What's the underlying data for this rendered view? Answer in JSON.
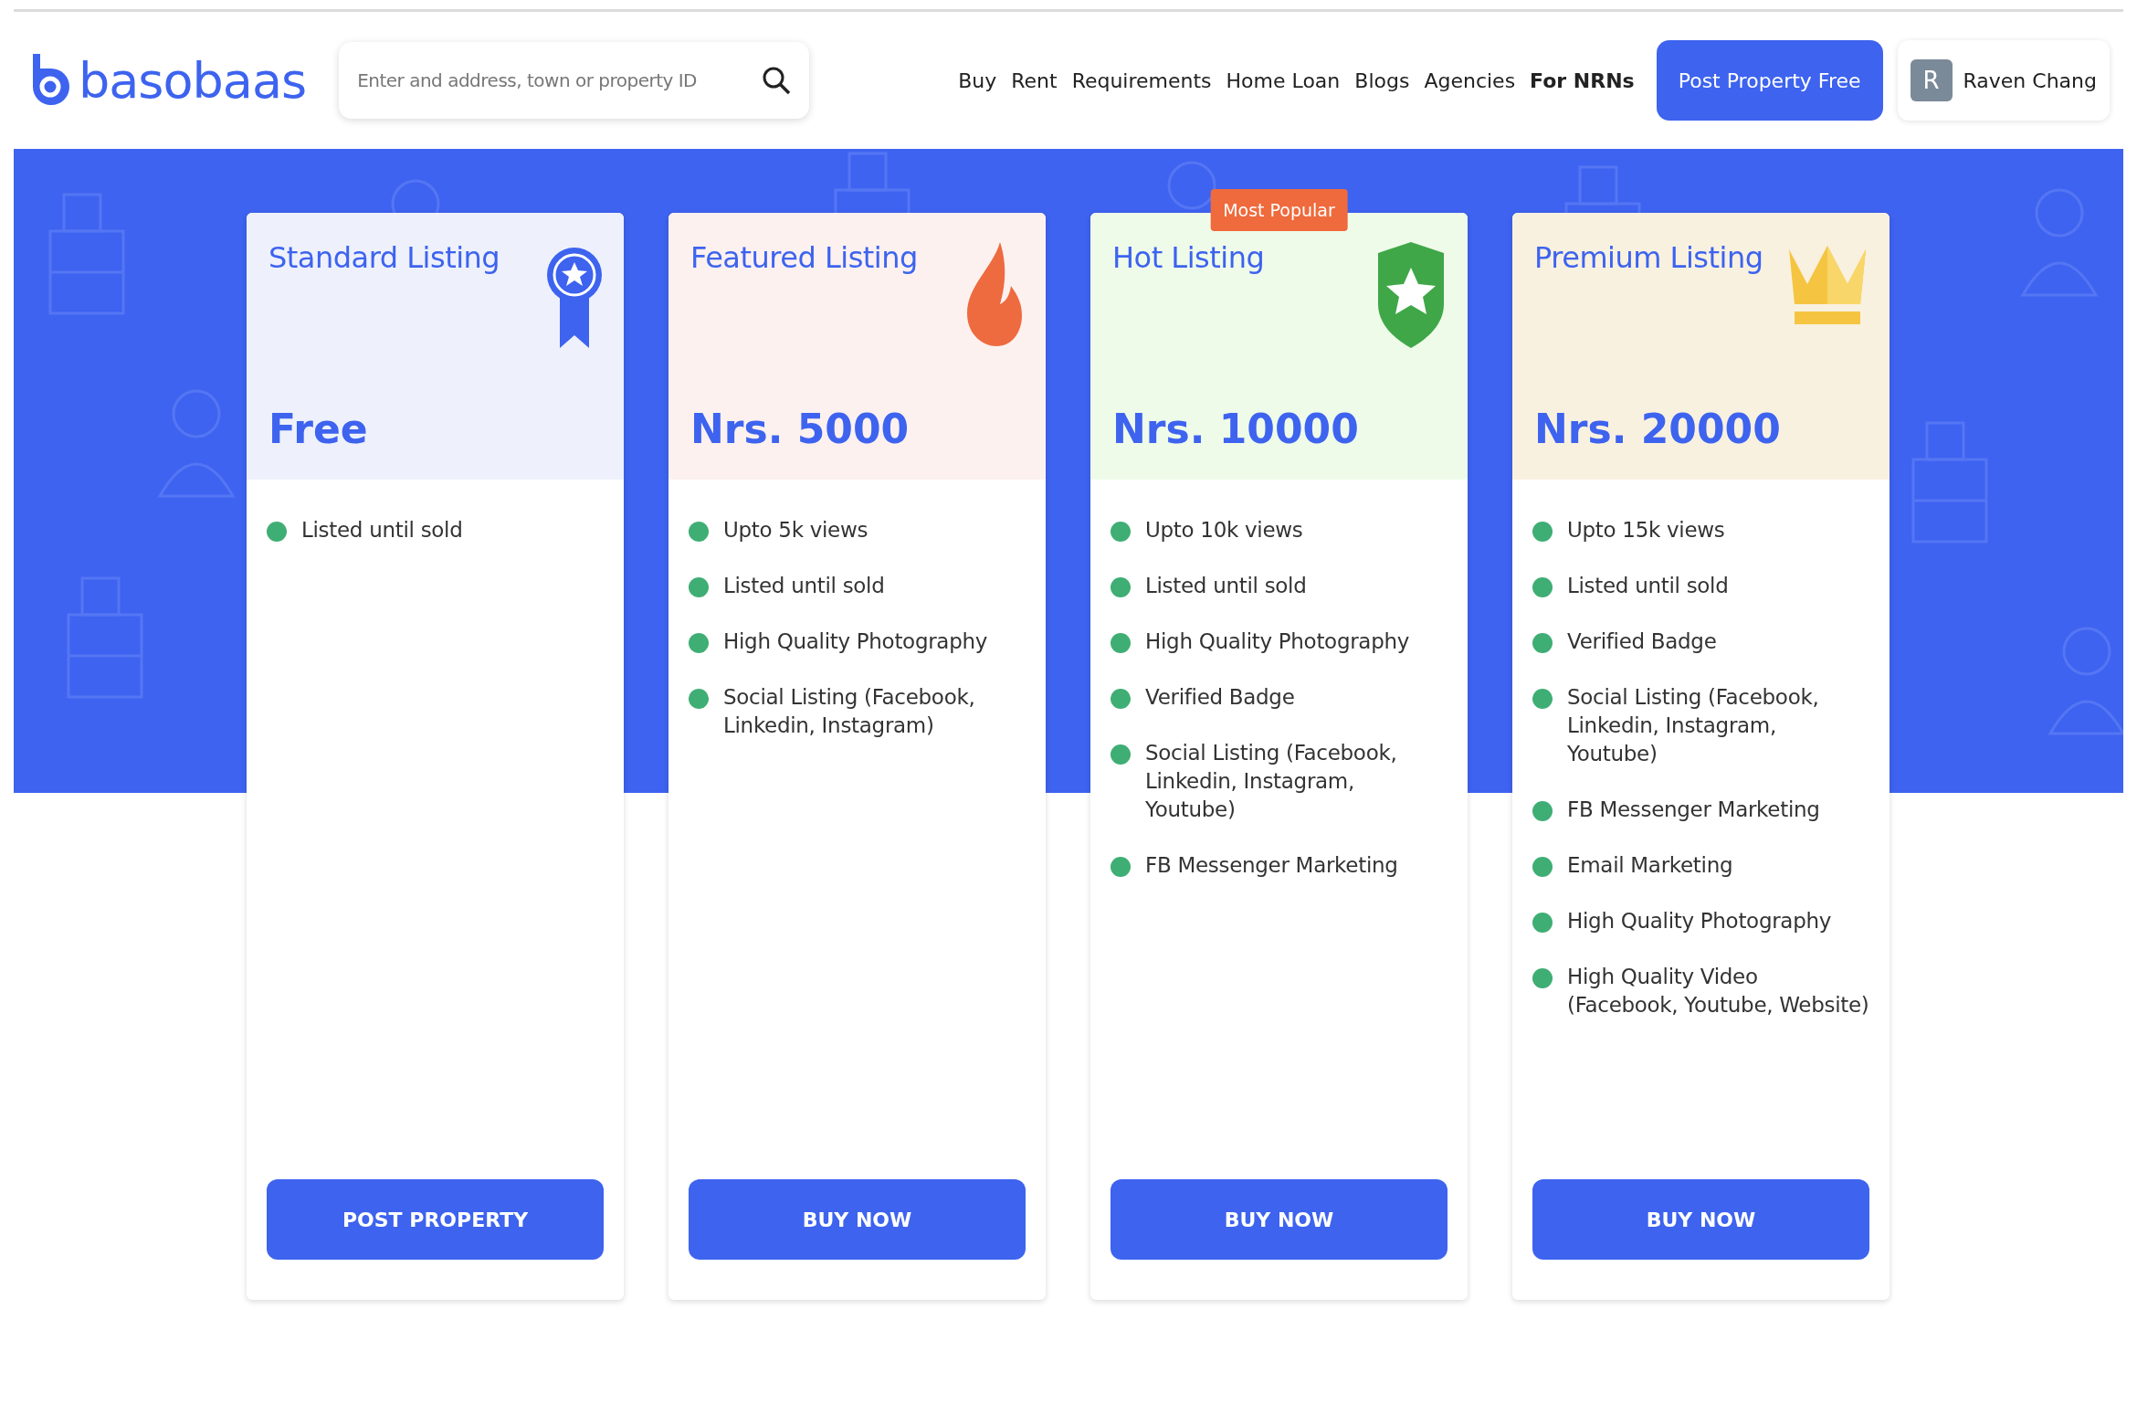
{
  "header": {
    "logo": "basobaas",
    "search": {
      "placeholder": "Enter and address, town or property ID"
    },
    "nav": [
      {
        "label": "Buy",
        "bold": false
      },
      {
        "label": "Rent",
        "bold": false
      },
      {
        "label": "Requirements",
        "bold": false
      },
      {
        "label": "Home Loan",
        "bold": false
      },
      {
        "label": "Blogs",
        "bold": false
      },
      {
        "label": "Agencies",
        "bold": false
      },
      {
        "label": "For NRNs",
        "bold": true
      }
    ],
    "post_button": "Post Property Free",
    "user": {
      "initial": "R",
      "name": "Raven Chang"
    }
  },
  "plans": [
    {
      "title": "Standard Listing",
      "price": "Free",
      "kind": "ribbon",
      "color": "#eef1fb",
      "features": [
        "Listed until sold"
      ],
      "button": "POST PROPERTY"
    },
    {
      "title": "Featured Listing",
      "price": "Nrs. 5000",
      "kind": "flame",
      "color": "#fcf1ef",
      "features": [
        "Upto 5k views",
        "Listed until sold",
        "High Quality Photography",
        "Social Listing (Facebook, Linkedin, Instagram)"
      ],
      "button": "BUY NOW"
    },
    {
      "title": "Hot Listing",
      "price": "Nrs. 10000",
      "kind": "shield",
      "color": "#effbe9",
      "badge": "Most Popular",
      "features": [
        "Upto 10k views",
        "Listed until sold",
        "High Quality Photography",
        "Verified Badge",
        "Social Listing (Facebook, Linkedin, Instagram, Youtube)",
        "FB Messenger Marketing"
      ],
      "button": "BUY NOW"
    },
    {
      "title": "Premium Listing",
      "price": "Nrs. 20000",
      "kind": "crown",
      "color": "#f9f1df",
      "features": [
        "Upto 15k views",
        "Listed until sold",
        "Verified Badge",
        "Social Listing (Facebook, Linkedin, Instagram, Youtube)",
        "FB Messenger Marketing",
        "Email Marketing",
        "High Quality Photography",
        "High Quality Video (Facebook, Youtube, Website)"
      ],
      "button": "BUY NOW"
    }
  ]
}
